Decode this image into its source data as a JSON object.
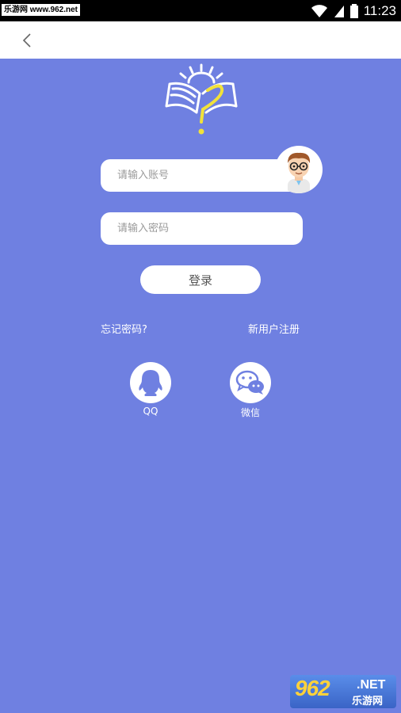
{
  "status_bar": {
    "watermark": "乐游网 www.962.net",
    "time": "11:23"
  },
  "nav": {
    "back_icon": "chevron-left-icon"
  },
  "login": {
    "account_placeholder": "请输入账号",
    "password_placeholder": "请输入密码",
    "login_button": "登录",
    "forgot_password": "忘记密码?",
    "register": "新用户注册"
  },
  "social": {
    "qq_label": "QQ",
    "wechat_label": "微信"
  },
  "watermark_badge": {
    "number": "962",
    "net": ".NET",
    "site_name": "乐游网"
  },
  "colors": {
    "background": "#6f80e1",
    "logo_yellow": "#f2e23a",
    "status_bar": "#000000"
  }
}
